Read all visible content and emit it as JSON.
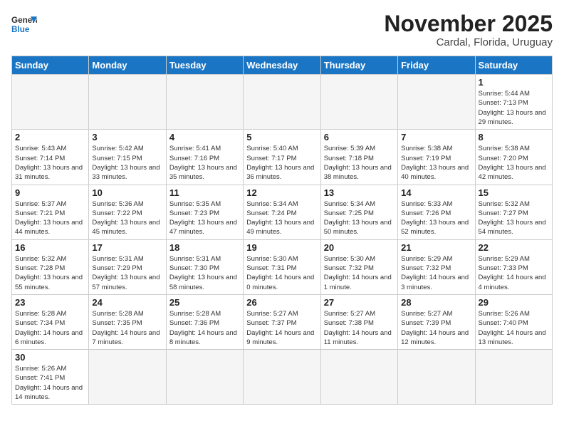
{
  "header": {
    "logo_general": "General",
    "logo_blue": "Blue",
    "month": "November 2025",
    "location": "Cardal, Florida, Uruguay"
  },
  "days_of_week": [
    "Sunday",
    "Monday",
    "Tuesday",
    "Wednesday",
    "Thursday",
    "Friday",
    "Saturday"
  ],
  "weeks": [
    [
      {
        "day": "",
        "info": ""
      },
      {
        "day": "",
        "info": ""
      },
      {
        "day": "",
        "info": ""
      },
      {
        "day": "",
        "info": ""
      },
      {
        "day": "",
        "info": ""
      },
      {
        "day": "",
        "info": ""
      },
      {
        "day": "1",
        "info": "Sunrise: 5:44 AM\nSunset: 7:13 PM\nDaylight: 13 hours and 29 minutes."
      }
    ],
    [
      {
        "day": "2",
        "info": "Sunrise: 5:43 AM\nSunset: 7:14 PM\nDaylight: 13 hours and 31 minutes."
      },
      {
        "day": "3",
        "info": "Sunrise: 5:42 AM\nSunset: 7:15 PM\nDaylight: 13 hours and 33 minutes."
      },
      {
        "day": "4",
        "info": "Sunrise: 5:41 AM\nSunset: 7:16 PM\nDaylight: 13 hours and 35 minutes."
      },
      {
        "day": "5",
        "info": "Sunrise: 5:40 AM\nSunset: 7:17 PM\nDaylight: 13 hours and 36 minutes."
      },
      {
        "day": "6",
        "info": "Sunrise: 5:39 AM\nSunset: 7:18 PM\nDaylight: 13 hours and 38 minutes."
      },
      {
        "day": "7",
        "info": "Sunrise: 5:38 AM\nSunset: 7:19 PM\nDaylight: 13 hours and 40 minutes."
      },
      {
        "day": "8",
        "info": "Sunrise: 5:38 AM\nSunset: 7:20 PM\nDaylight: 13 hours and 42 minutes."
      }
    ],
    [
      {
        "day": "9",
        "info": "Sunrise: 5:37 AM\nSunset: 7:21 PM\nDaylight: 13 hours and 44 minutes."
      },
      {
        "day": "10",
        "info": "Sunrise: 5:36 AM\nSunset: 7:22 PM\nDaylight: 13 hours and 45 minutes."
      },
      {
        "day": "11",
        "info": "Sunrise: 5:35 AM\nSunset: 7:23 PM\nDaylight: 13 hours and 47 minutes."
      },
      {
        "day": "12",
        "info": "Sunrise: 5:34 AM\nSunset: 7:24 PM\nDaylight: 13 hours and 49 minutes."
      },
      {
        "day": "13",
        "info": "Sunrise: 5:34 AM\nSunset: 7:25 PM\nDaylight: 13 hours and 50 minutes."
      },
      {
        "day": "14",
        "info": "Sunrise: 5:33 AM\nSunset: 7:26 PM\nDaylight: 13 hours and 52 minutes."
      },
      {
        "day": "15",
        "info": "Sunrise: 5:32 AM\nSunset: 7:27 PM\nDaylight: 13 hours and 54 minutes."
      }
    ],
    [
      {
        "day": "16",
        "info": "Sunrise: 5:32 AM\nSunset: 7:28 PM\nDaylight: 13 hours and 55 minutes."
      },
      {
        "day": "17",
        "info": "Sunrise: 5:31 AM\nSunset: 7:29 PM\nDaylight: 13 hours and 57 minutes."
      },
      {
        "day": "18",
        "info": "Sunrise: 5:31 AM\nSunset: 7:30 PM\nDaylight: 13 hours and 58 minutes."
      },
      {
        "day": "19",
        "info": "Sunrise: 5:30 AM\nSunset: 7:31 PM\nDaylight: 14 hours and 0 minutes."
      },
      {
        "day": "20",
        "info": "Sunrise: 5:30 AM\nSunset: 7:32 PM\nDaylight: 14 hours and 1 minute."
      },
      {
        "day": "21",
        "info": "Sunrise: 5:29 AM\nSunset: 7:32 PM\nDaylight: 14 hours and 3 minutes."
      },
      {
        "day": "22",
        "info": "Sunrise: 5:29 AM\nSunset: 7:33 PM\nDaylight: 14 hours and 4 minutes."
      }
    ],
    [
      {
        "day": "23",
        "info": "Sunrise: 5:28 AM\nSunset: 7:34 PM\nDaylight: 14 hours and 6 minutes."
      },
      {
        "day": "24",
        "info": "Sunrise: 5:28 AM\nSunset: 7:35 PM\nDaylight: 14 hours and 7 minutes."
      },
      {
        "day": "25",
        "info": "Sunrise: 5:28 AM\nSunset: 7:36 PM\nDaylight: 14 hours and 8 minutes."
      },
      {
        "day": "26",
        "info": "Sunrise: 5:27 AM\nSunset: 7:37 PM\nDaylight: 14 hours and 9 minutes."
      },
      {
        "day": "27",
        "info": "Sunrise: 5:27 AM\nSunset: 7:38 PM\nDaylight: 14 hours and 11 minutes."
      },
      {
        "day": "28",
        "info": "Sunrise: 5:27 AM\nSunset: 7:39 PM\nDaylight: 14 hours and 12 minutes."
      },
      {
        "day": "29",
        "info": "Sunrise: 5:26 AM\nSunset: 7:40 PM\nDaylight: 14 hours and 13 minutes."
      }
    ],
    [
      {
        "day": "30",
        "info": "Sunrise: 5:26 AM\nSunset: 7:41 PM\nDaylight: 14 hours and 14 minutes."
      },
      {
        "day": "",
        "info": ""
      },
      {
        "day": "",
        "info": ""
      },
      {
        "day": "",
        "info": ""
      },
      {
        "day": "",
        "info": ""
      },
      {
        "day": "",
        "info": ""
      },
      {
        "day": "",
        "info": ""
      }
    ]
  ]
}
